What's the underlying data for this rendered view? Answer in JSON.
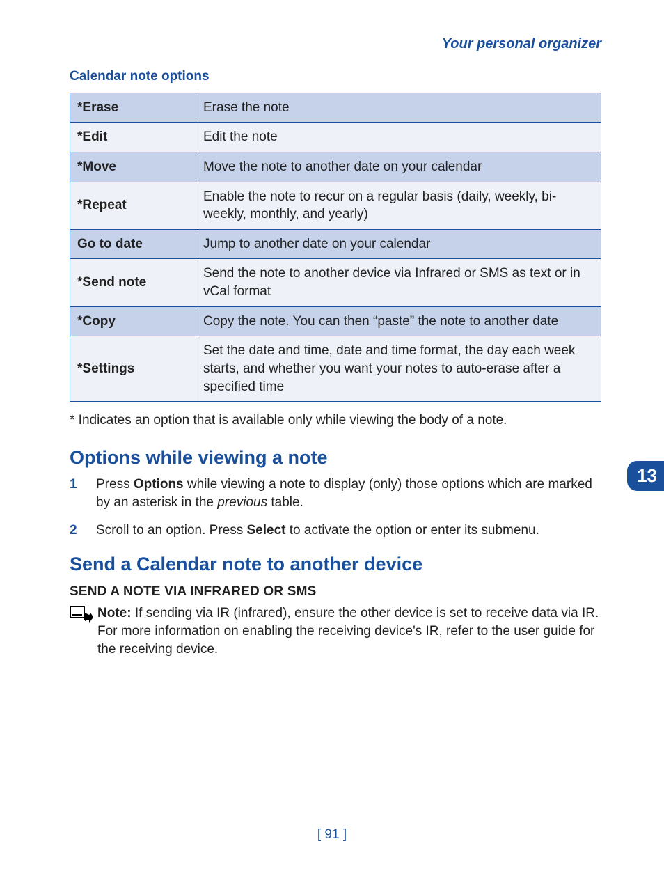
{
  "header": "Your personal organizer",
  "section_table_title": "Calendar note options",
  "table": [
    {
      "name": "*Erase",
      "desc": "Erase the note"
    },
    {
      "name": "*Edit",
      "desc": "Edit the note"
    },
    {
      "name": "*Move",
      "desc": "Move the note to another date on your calendar"
    },
    {
      "name": "*Repeat",
      "desc": "Enable the note to recur on a regular basis (daily, weekly, bi-weekly, monthly, and yearly)"
    },
    {
      "name": "Go to date",
      "desc": "Jump to another date on your calendar"
    },
    {
      "name": "*Send note",
      "desc": "Send the note to another device via Infrared or SMS as text or in vCal format"
    },
    {
      "name": "*Copy",
      "desc": "Copy the note. You can then “paste” the note to another date"
    },
    {
      "name": "*Settings",
      "desc": "Set the date and time, date and time format, the day each week starts, and whether you want your notes to auto-erase after a specified time"
    }
  ],
  "footnote": "* Indicates an option that is available only while viewing the body of a note.",
  "chapter_number": "13",
  "section1_title": "Options while viewing a note",
  "step1_pre": "Press ",
  "step1_bold": "Options",
  "step1_mid": " while viewing a note to display (only) those options which are marked by an asterisk in the ",
  "step1_italic": "previous",
  "step1_post": " table.",
  "step2_pre": "Scroll to an option. Press ",
  "step2_bold": "Select",
  "step2_post": " to activate the option or enter its submenu.",
  "section2_title": "Send a Calendar note to another device",
  "subhead": "SEND A NOTE VIA INFRARED OR SMS",
  "note_bold": "Note:",
  "note_body": " If sending via IR (infrared), ensure the other device is set to receive data via IR. For more information on enabling the receiving device's IR, refer to the user guide for the receiving device.",
  "page_number": "[ 91 ]",
  "step_nums": {
    "one": "1",
    "two": "2"
  }
}
